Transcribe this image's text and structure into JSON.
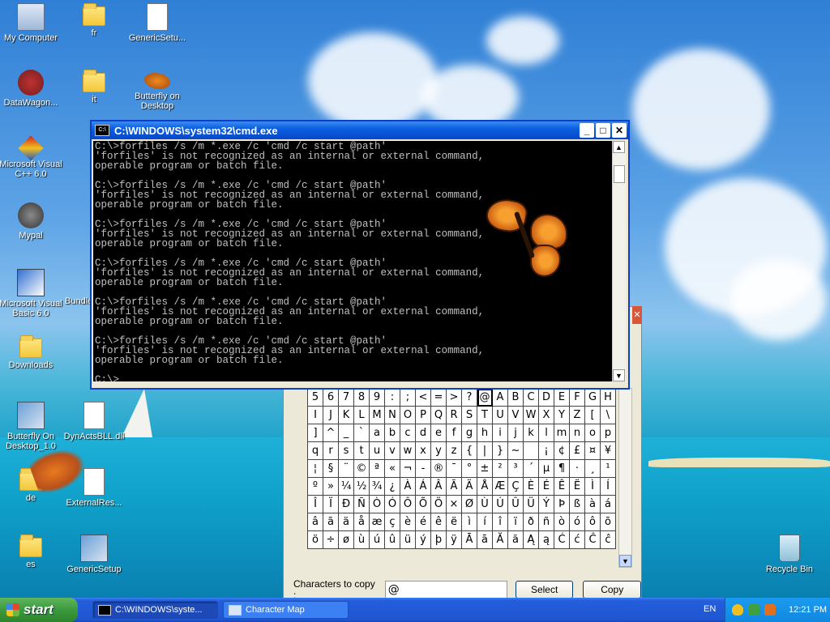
{
  "desktop": {
    "icons": [
      {
        "label": "My Computer",
        "icon": "my-computer-icon"
      },
      {
        "label": "fr",
        "icon": "folder-icon"
      },
      {
        "label": "GenericSetu...",
        "icon": "setup-file-icon"
      },
      {
        "label": "DataWagon...",
        "icon": "datawagon-icon"
      },
      {
        "label": "it",
        "icon": "folder-icon"
      },
      {
        "label": "Butterfly on Desktop",
        "icon": "butterfly-icon"
      },
      {
        "label": "Microsoft Visual C++ 6.0",
        "icon": "visual-cpp-icon"
      },
      {
        "label": "Mypal",
        "icon": "mypal-icon"
      },
      {
        "label": "Microsoft Visual Basic 6.0",
        "icon": "visual-basic-icon"
      },
      {
        "label": "Bundle",
        "icon": "folder-icon"
      },
      {
        "label": "Downloads",
        "icon": "folder-icon"
      },
      {
        "label": "Butterfly On Desktop_1.0",
        "icon": "installer-icon"
      },
      {
        "label": "DynActsBLL.dll",
        "icon": "dll-icon"
      },
      {
        "label": "de",
        "icon": "folder-icon"
      },
      {
        "label": "ExternalRes...",
        "icon": "document-icon"
      },
      {
        "label": "es",
        "icon": "folder-icon"
      },
      {
        "label": "GenericSetup",
        "icon": "setup-icon"
      },
      {
        "label": "Recycle Bin",
        "icon": "recycle-bin-icon"
      }
    ]
  },
  "cmd": {
    "title": "C:\\WINDOWS\\system32\\cmd.exe",
    "lines": [
      "C:\\>forfiles /s /m *.exe /c 'cmd /c start @path'",
      "'forfiles' is not recognized as an internal or external command,",
      "operable program or batch file.",
      "",
      "C:\\>forfiles /s /m *.exe /c 'cmd /c start @path'",
      "'forfiles' is not recognized as an internal or external command,",
      "operable program or batch file.",
      "",
      "C:\\>forfiles /s /m *.exe /c 'cmd /c start @path'",
      "'forfiles' is not recognized as an internal or external command,",
      "operable program or batch file.",
      "",
      "C:\\>forfiles /s /m *.exe /c 'cmd /c start @path'",
      "'forfiles' is not recognized as an internal or external command,",
      "operable program or batch file.",
      "",
      "C:\\>forfiles /s /m *.exe /c 'cmd /c start @path'",
      "'forfiles' is not recognized as an internal or external command,",
      "operable program or batch file.",
      "",
      "C:\\>forfiles /s /m *.exe /c 'cmd /c start @path'",
      "'forfiles' is not recognized as an internal or external command,",
      "operable program or batch file.",
      "",
      "C:\\>_"
    ]
  },
  "charmap": {
    "rows": [
      [
        "5",
        "6",
        "7",
        "8",
        "9",
        ":",
        ";",
        "<",
        "=",
        ">",
        "?",
        "@",
        "A",
        "B",
        "C",
        "D",
        "E",
        "F",
        "G",
        "H"
      ],
      [
        "I",
        "J",
        "K",
        "L",
        "M",
        "N",
        "O",
        "P",
        "Q",
        "R",
        "S",
        "T",
        "U",
        "V",
        "W",
        "X",
        "Y",
        "Z",
        "[",
        "\\"
      ],
      [
        "]",
        "^",
        "_",
        "`",
        "a",
        "b",
        "c",
        "d",
        "e",
        "f",
        "g",
        "h",
        "i",
        "j",
        "k",
        "l",
        "m",
        "n",
        "o",
        "p"
      ],
      [
        "q",
        "r",
        "s",
        "t",
        "u",
        "v",
        "w",
        "x",
        "y",
        "z",
        "{",
        "|",
        "}",
        "~",
        " ",
        "¡",
        "¢",
        "£",
        "¤",
        "¥"
      ],
      [
        "¦",
        "§",
        "¨",
        "©",
        "ª",
        "«",
        "¬",
        "-",
        "®",
        "¯",
        "°",
        "±",
        "²",
        "³",
        "´",
        "µ",
        "¶",
        "·",
        "¸",
        "¹"
      ],
      [
        "º",
        "»",
        "¼",
        "½",
        "¾",
        "¿",
        "À",
        "Á",
        "Â",
        "Ã",
        "Ä",
        "Å",
        "Æ",
        "Ç",
        "È",
        "É",
        "Ê",
        "Ë",
        "Ì",
        "Í"
      ],
      [
        "Î",
        "Ï",
        "Ð",
        "Ñ",
        "Ò",
        "Ó",
        "Ô",
        "Õ",
        "Ö",
        "×",
        "Ø",
        "Ù",
        "Ú",
        "Û",
        "Ü",
        "Ý",
        "Þ",
        "ß",
        "à",
        "á"
      ],
      [
        "â",
        "ã",
        "ä",
        "å",
        "æ",
        "ç",
        "è",
        "é",
        "ê",
        "ë",
        "ì",
        "í",
        "î",
        "ï",
        "ð",
        "ñ",
        "ò",
        "ó",
        "ô",
        "õ"
      ],
      [
        "ö",
        "÷",
        "ø",
        "ù",
        "ú",
        "û",
        "ü",
        "ý",
        "þ",
        "ÿ",
        "Ā",
        "ā",
        "Ă",
        "ă",
        "Ą",
        "ą",
        "Ć",
        "ć",
        "Ĉ",
        "ĉ"
      ]
    ],
    "selected": "@",
    "copy_label": "Characters to copy :",
    "copy_value": "@",
    "select_label": "Select",
    "copy_button": "Copy"
  },
  "taskbar": {
    "start_label": "start",
    "tasks": [
      "C:\\WINDOWS\\syste...",
      "Character Map"
    ],
    "language": "EN",
    "clock": "12:21 PM"
  },
  "colors": {
    "title_blue": "#0a5fe0",
    "start_green": "#3c9a3c",
    "console_bg": "#000000",
    "console_text": "#c0c0c0"
  }
}
